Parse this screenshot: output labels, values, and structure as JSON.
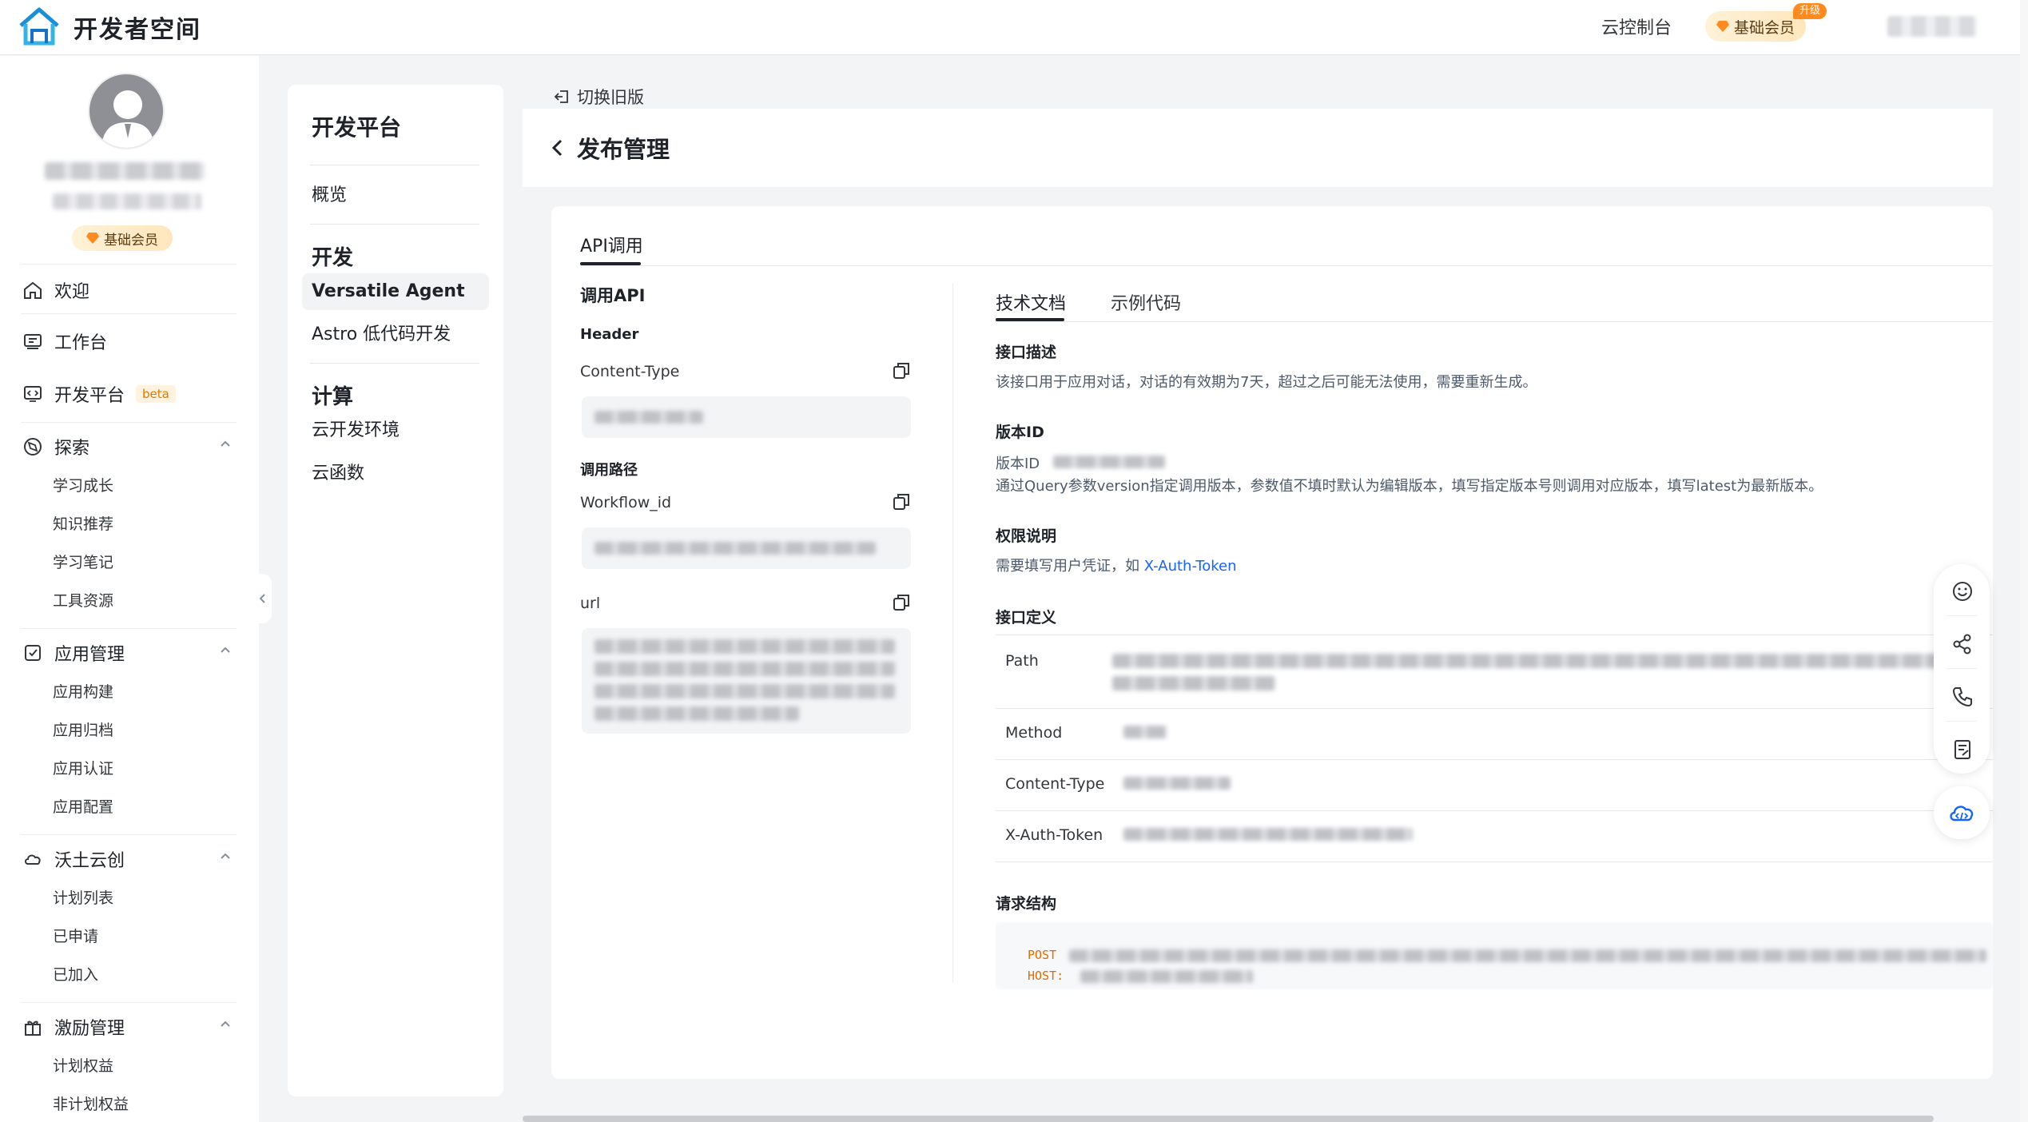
{
  "app": {
    "title": "开发者空间"
  },
  "topbar": {
    "console_label": "云控制台",
    "member_label": "基础会员",
    "upgrade_label": "升级"
  },
  "sidebar": {
    "member_label": "基础会员",
    "welcome": "欢迎",
    "workbench": "工作台",
    "dev_platform": "开发平台",
    "beta": "beta",
    "explore": {
      "label": "探索",
      "items": [
        "学习成长",
        "知识推荐",
        "学习笔记",
        "工具资源"
      ]
    },
    "app_mgmt": {
      "label": "应用管理",
      "items": [
        "应用构建",
        "应用归档",
        "应用认证",
        "应用配置"
      ]
    },
    "wotu": {
      "label": "沃土云创",
      "items": [
        "计划列表",
        "已申请",
        "已加入"
      ]
    },
    "incentive": {
      "label": "激励管理",
      "items": [
        "计划权益",
        "非计划权益"
      ]
    }
  },
  "dev_panel": {
    "title": "开发平台",
    "overview": "概览",
    "develop": "开发",
    "versatile": "Versatile Agent",
    "astro": "Astro 低代码开发",
    "compute": "计算",
    "cloud_env": "云开发环境",
    "cloud_func": "云函数"
  },
  "main": {
    "old_version": "切换旧版",
    "title": "发布管理",
    "tab_api": "API调用",
    "left": {
      "title": "调用API",
      "header": "Header",
      "content_type": "Content-Type",
      "call_path": "调用路径",
      "workflow_id": "Workflow_id",
      "url": "url"
    },
    "right": {
      "tab_docs": "技术文档",
      "tab_code": "示例代码",
      "desc_title": "接口描述",
      "desc_text": "该接口用于应用对话，对话的有效期为7天，超过之后可能无法使用，需要重新生成。",
      "version_title": "版本ID",
      "version_label": "版本ID",
      "version_text": "通过Query参数version指定调用版本，参数值不填时默认为编辑版本，填写指定版本号则调用对应版本，填写latest为最新版本。",
      "perm_title": "权限说明",
      "perm_text": "需要填写用户凭证，如 ",
      "perm_link": "X-Auth-Token",
      "def_title": "接口定义",
      "def_path": "Path",
      "def_method": "Method",
      "def_content_type": "Content-Type",
      "def_token": "X-Auth-Token",
      "req_title": "请求结构",
      "code_post": "POST",
      "code_host": "HOST:"
    }
  }
}
